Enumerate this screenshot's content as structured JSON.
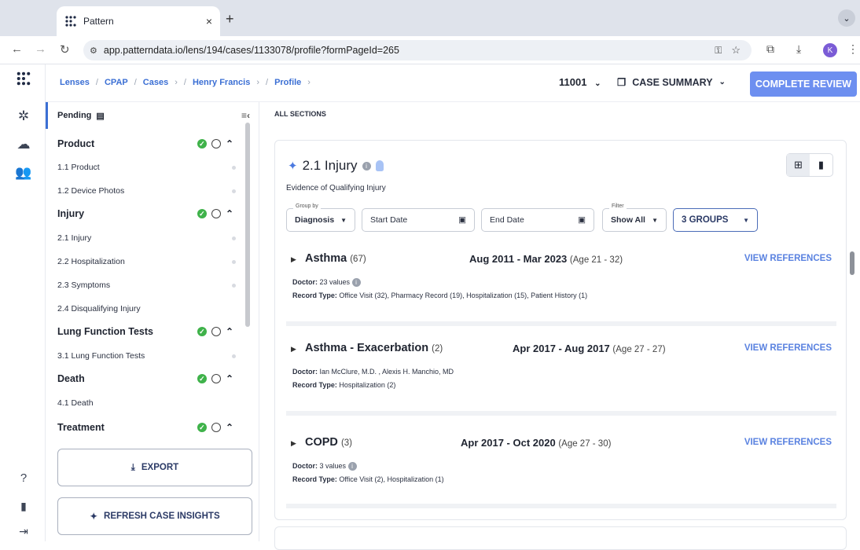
{
  "browser": {
    "tab_title": "Pattern",
    "tab_close": "×",
    "new_tab": "+",
    "tab_menu": "⌄",
    "url": "app.patterndata.io/lens/194/cases/1133078/profile?formPageId=265",
    "profile_initial": "K"
  },
  "breadcrumb": {
    "items": [
      "Lenses",
      "CPAP",
      "Cases",
      "Henry Francis",
      "Profile"
    ]
  },
  "header": {
    "case_number": "11001",
    "case_summary": "CASE SUMMARY",
    "complete_review": "COMPLETE REVIEW"
  },
  "sidebar": {
    "pending": "Pending",
    "sections": [
      {
        "label": "Product",
        "items": [
          "1.1 Product",
          "1.2 Device Photos"
        ]
      },
      {
        "label": "Injury",
        "items": [
          "2.1 Injury",
          "2.2 Hospitalization",
          "2.3 Symptoms",
          "2.4 Disqualifying Injury"
        ]
      },
      {
        "label": "Lung Function Tests",
        "items": [
          "3.1 Lung Function Tests"
        ]
      },
      {
        "label": "Death",
        "items": [
          "4.1 Death"
        ]
      },
      {
        "label": "Treatment",
        "items": []
      }
    ],
    "export": "EXPORT",
    "refresh": "REFRESH CASE INSIGHTS"
  },
  "main": {
    "all_sections": "ALL SECTIONS",
    "card": {
      "title": "2.1 Injury",
      "subtitle": "Evidence of Qualifying Injury",
      "group_by_label": "Group by",
      "group_by_value": "Diagnosis",
      "start_date": "Start Date",
      "end_date": "End Date",
      "filter_label": "Filter",
      "filter_value": "Show All",
      "groups_button": "3 GROUPS",
      "entries": [
        {
          "name": "Asthma",
          "count": "(67)",
          "range": "Aug 2011 - Mar 2023",
          "age": "(Age 21 - 32)",
          "view": "VIEW REFERENCES",
          "doctor_label": "Doctor:",
          "doctor": "23 values",
          "record_label": "Record Type:",
          "record": "Office Visit (32), Pharmacy Record (19), Hospitalization (15), Patient History (1)"
        },
        {
          "name": "Asthma - Exacerbation",
          "count": "(2)",
          "range": "Apr 2017 - Aug 2017",
          "age": "(Age 27 - 27)",
          "view": "VIEW REFERENCES",
          "doctor_label": "Doctor:",
          "doctor": "Ian McClure, M.D. ,  Alexis H. Manchio, MD",
          "record_label": "Record Type:",
          "record": "Hospitalization (2)"
        },
        {
          "name": "COPD",
          "count": "(3)",
          "range": "Apr 2017 - Oct 2020",
          "age": "(Age 27 - 30)",
          "view": "VIEW REFERENCES",
          "doctor_label": "Doctor:",
          "doctor": "3 values",
          "record_label": "Record Type:",
          "record": "Office Visit (2),  Hospitalization (1)"
        }
      ]
    }
  },
  "colors": {
    "accent": "#3b6fd4",
    "review_button": "#6d8ff0",
    "success": "#3fb24a"
  }
}
